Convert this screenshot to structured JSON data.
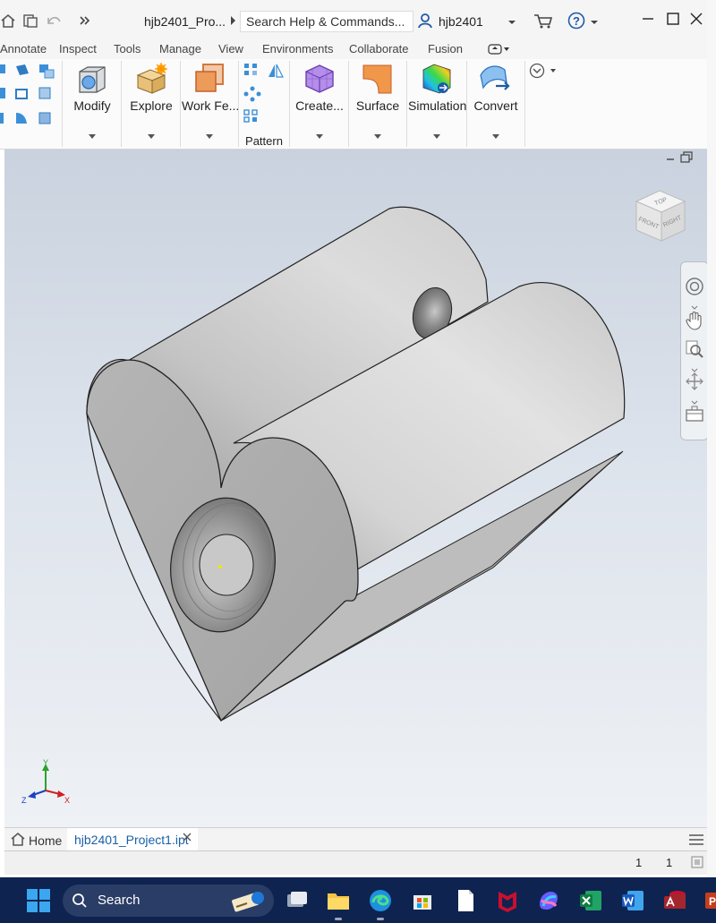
{
  "titlebar": {
    "doc_title": "hjb2401_Pro...",
    "search_placeholder": "Search Help & Commands...",
    "user": "hjb2401",
    "help": "?"
  },
  "tabs": [
    "Annotate",
    "Inspect",
    "Tools",
    "Manage",
    "View",
    "Environments",
    "Collaborate",
    "Fusion"
  ],
  "ribbon": {
    "buttons": [
      "Modify",
      "Explore",
      "Work Fe...",
      "Pattern",
      "Create...",
      "Surface",
      "Simulation",
      "Convert"
    ]
  },
  "viewcube": {
    "top": "TOP",
    "front": "FRONT",
    "right": "RIGHT"
  },
  "triad": {
    "x": "X",
    "y": "Y",
    "z": "Z"
  },
  "doctabs": {
    "home": "Home",
    "active_file": "hjb2401_Project1.ipt"
  },
  "status": {
    "count1": "1",
    "count2": "1"
  },
  "taskbar": {
    "search": "Search"
  },
  "colors": {
    "accent": "#0696d7",
    "taskbar": "#0e2350",
    "model": "#c8c8c8"
  }
}
